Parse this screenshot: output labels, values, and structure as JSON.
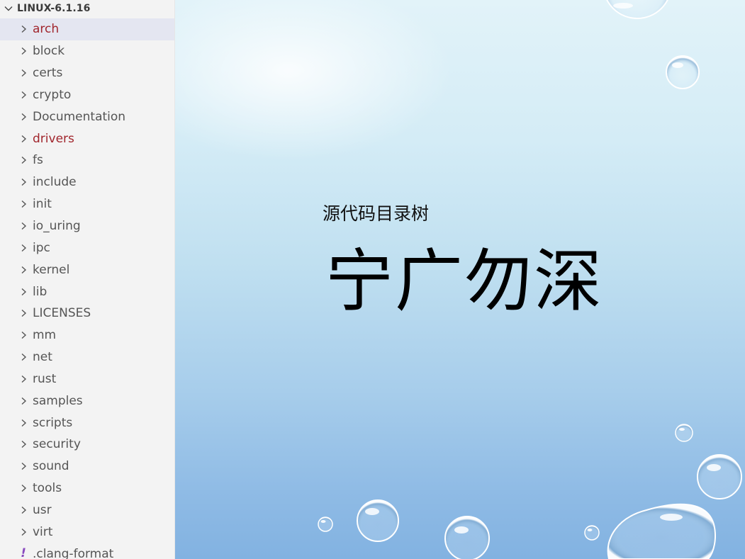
{
  "explorer": {
    "root_label": "LINUX-6.1.16",
    "items": [
      {
        "label": "arch",
        "type": "folder",
        "modified": true,
        "selected": true
      },
      {
        "label": "block",
        "type": "folder",
        "modified": false,
        "selected": false
      },
      {
        "label": "certs",
        "type": "folder",
        "modified": false,
        "selected": false
      },
      {
        "label": "crypto",
        "type": "folder",
        "modified": false,
        "selected": false
      },
      {
        "label": "Documentation",
        "type": "folder",
        "modified": false,
        "selected": false
      },
      {
        "label": "drivers",
        "type": "folder",
        "modified": true,
        "selected": false
      },
      {
        "label": "fs",
        "type": "folder",
        "modified": false,
        "selected": false
      },
      {
        "label": "include",
        "type": "folder",
        "modified": false,
        "selected": false
      },
      {
        "label": "init",
        "type": "folder",
        "modified": false,
        "selected": false
      },
      {
        "label": "io_uring",
        "type": "folder",
        "modified": false,
        "selected": false
      },
      {
        "label": "ipc",
        "type": "folder",
        "modified": false,
        "selected": false
      },
      {
        "label": "kernel",
        "type": "folder",
        "modified": false,
        "selected": false
      },
      {
        "label": "lib",
        "type": "folder",
        "modified": false,
        "selected": false
      },
      {
        "label": "LICENSES",
        "type": "folder",
        "modified": false,
        "selected": false
      },
      {
        "label": "mm",
        "type": "folder",
        "modified": false,
        "selected": false
      },
      {
        "label": "net",
        "type": "folder",
        "modified": false,
        "selected": false
      },
      {
        "label": "rust",
        "type": "folder",
        "modified": false,
        "selected": false
      },
      {
        "label": "samples",
        "type": "folder",
        "modified": false,
        "selected": false
      },
      {
        "label": "scripts",
        "type": "folder",
        "modified": false,
        "selected": false
      },
      {
        "label": "security",
        "type": "folder",
        "modified": false,
        "selected": false
      },
      {
        "label": "sound",
        "type": "folder",
        "modified": false,
        "selected": false
      },
      {
        "label": "tools",
        "type": "folder",
        "modified": false,
        "selected": false
      },
      {
        "label": "usr",
        "type": "folder",
        "modified": false,
        "selected": false
      },
      {
        "label": "virt",
        "type": "folder",
        "modified": false,
        "selected": false
      },
      {
        "label": ".clang-format",
        "type": "file",
        "icon": "exclamation-icon",
        "modified": false,
        "selected": false
      }
    ]
  },
  "slide": {
    "subtitle": "源代码目录树",
    "title": "宁广勿深"
  },
  "colors": {
    "sidebar_bg": "#f3f3f3",
    "selected_bg": "#e4e6f1",
    "modified_text": "#a1262d",
    "normal_text": "#555555",
    "file_icon": "#8a4bbf"
  }
}
